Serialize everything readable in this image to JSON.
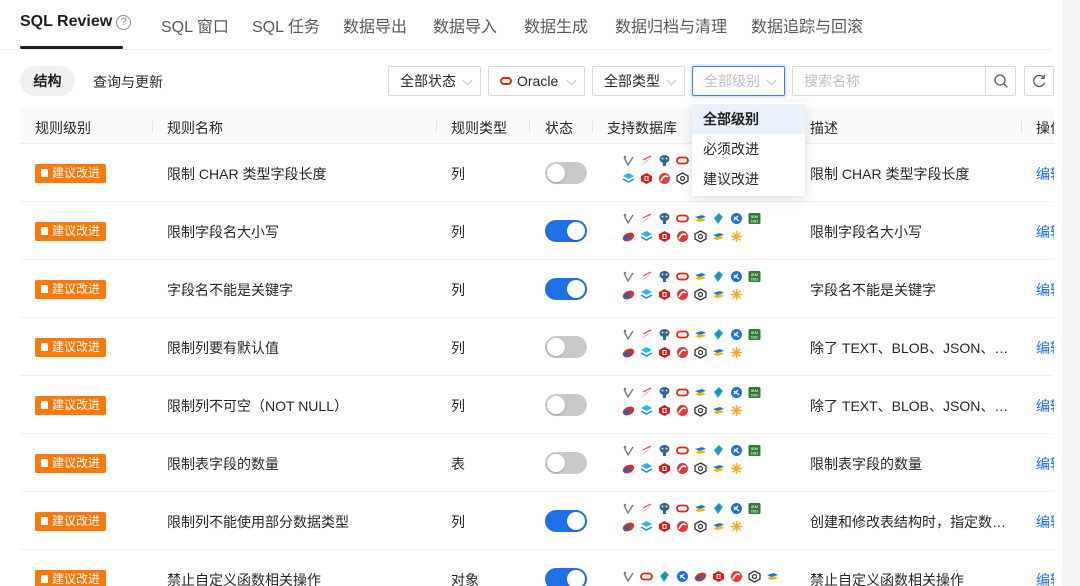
{
  "top_tabs": [
    {
      "label": "SQL Review",
      "help_glyph": "?"
    },
    {
      "label": "SQL 窗口"
    },
    {
      "label": "SQL 任务"
    },
    {
      "label": "数据导出"
    },
    {
      "label": "数据导入"
    },
    {
      "label": "数据生成"
    },
    {
      "label": "数据归档与清理"
    },
    {
      "label": "数据追踪与回滚"
    }
  ],
  "view_switch": {
    "active": "结构",
    "other": "查询与更新"
  },
  "filters": {
    "status": "全部状态",
    "database": "Oracle",
    "rule_type": "全部类型",
    "level": "全部级别"
  },
  "search": {
    "placeholder": "搜索名称"
  },
  "level_menu": {
    "options": [
      "全部级别",
      "必须改进",
      "建议改进"
    ],
    "selected": "全部级别"
  },
  "table": {
    "headers": [
      "规则级别",
      "规则名称",
      "规则类型",
      "状态",
      "支持数据库",
      "描述",
      "操作"
    ],
    "rows": [
      {
        "level": "建议改进",
        "name": "限制 CHAR 类型字段长度",
        "type": "列",
        "enabled": false,
        "desc": "限制 CHAR 类型字段长度",
        "action": "编辑",
        "db_icons": [
          [
            "ob",
            "oceanbase",
            "pg",
            "oracle"
          ],
          [
            "tidb",
            "huawei",
            "polardb",
            "gauss"
          ]
        ]
      },
      {
        "level": "建议改进",
        "name": "限制字段名大小写",
        "type": "列",
        "enabled": true,
        "desc": "限制字段名大小写",
        "action": "编辑",
        "db_icons": [
          [
            "ob",
            "oceanbase",
            "pg",
            "oracle",
            "sqlserver",
            "dm",
            "oceanbase2",
            "db2"
          ],
          [
            "kingbase",
            "tidb",
            "huawei",
            "polardb",
            "gauss",
            "sqlserver",
            "star"
          ]
        ]
      },
      {
        "level": "建议改进",
        "name": "字段名不能是关键字",
        "type": "列",
        "enabled": true,
        "desc": "字段名不能是关键字",
        "action": "编辑",
        "db_icons": [
          [
            "ob",
            "oceanbase",
            "pg",
            "oracle",
            "sqlserver",
            "dm",
            "oceanbase2",
            "db2"
          ],
          [
            "kingbase",
            "tidb",
            "huawei",
            "polardb",
            "gauss",
            "sqlserver",
            "star"
          ]
        ]
      },
      {
        "level": "建议改进",
        "name": "限制列要有默认值",
        "type": "列",
        "enabled": false,
        "desc": "除了 TEXT、BLOB、JSON、GEO...",
        "action": "编辑",
        "db_icons": [
          [
            "ob",
            "oceanbase",
            "pg",
            "oracle",
            "sqlserver",
            "dm",
            "oceanbase2",
            "db2"
          ],
          [
            "kingbase",
            "tidb",
            "huawei",
            "polardb",
            "gauss",
            "sqlserver",
            "star"
          ]
        ]
      },
      {
        "level": "建议改进",
        "name": "限制列不可空（NOT NULL）",
        "type": "列",
        "enabled": false,
        "desc": "除了 TEXT、BLOB、JSON、GEO...",
        "action": "编辑",
        "db_icons": [
          [
            "ob",
            "oceanbase",
            "pg",
            "oracle",
            "sqlserver",
            "dm",
            "oceanbase2",
            "db2"
          ],
          [
            "kingbase",
            "tidb",
            "huawei",
            "polardb",
            "gauss",
            "sqlserver",
            "star"
          ]
        ]
      },
      {
        "level": "建议改进",
        "name": "限制表字段的数量",
        "type": "表",
        "enabled": false,
        "desc": "限制表字段的数量",
        "action": "编辑",
        "db_icons": [
          [
            "ob",
            "oceanbase",
            "pg",
            "oracle",
            "sqlserver",
            "dm",
            "oceanbase2",
            "db2"
          ],
          [
            "kingbase",
            "tidb",
            "huawei",
            "polardb",
            "gauss",
            "sqlserver",
            "star"
          ]
        ]
      },
      {
        "level": "建议改进",
        "name": "限制列不能使用部分数据类型",
        "type": "列",
        "enabled": true,
        "desc": "创建和修改表结构时，指定数据...",
        "action": "编辑",
        "db_icons": [
          [
            "ob",
            "oceanbase",
            "pg",
            "oracle",
            "sqlserver",
            "dm",
            "oceanbase2",
            "db2"
          ],
          [
            "kingbase",
            "tidb",
            "huawei",
            "polardb",
            "gauss",
            "sqlserver",
            "star"
          ]
        ]
      },
      {
        "level": "建议改进",
        "name": "禁止自定义函数相关操作",
        "type": "对象",
        "enabled": true,
        "desc": "禁止自定义函数相关操作",
        "action": "编辑",
        "db_icons": [
          [
            "ob",
            "oracle",
            "dm",
            "oceanbase2",
            "kingbase",
            "huawei",
            "polardb",
            "gauss",
            "sqlserver"
          ]
        ]
      }
    ]
  },
  "colors": {
    "accent": "#1f6fe8",
    "badge": "#f77a0c",
    "toggle_off": "#c9c9c9"
  }
}
